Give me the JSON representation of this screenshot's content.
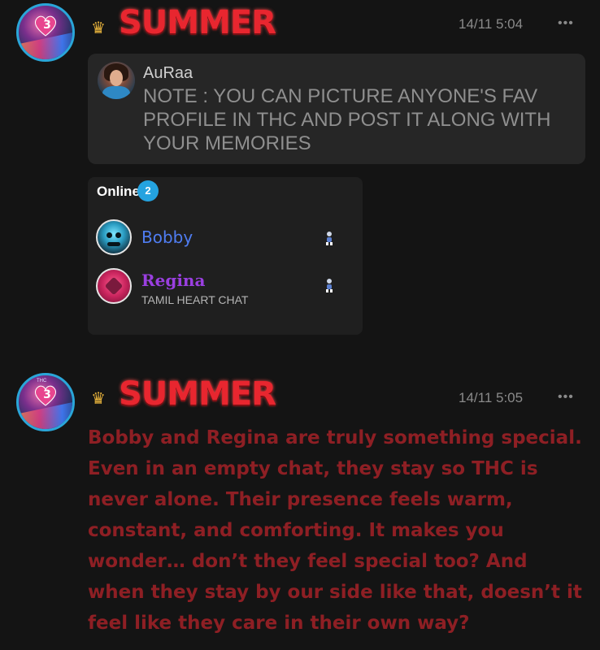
{
  "messages": [
    {
      "author": "SUMMER",
      "timestamp": "14/11 5:04",
      "avatar_label": "3",
      "quote": {
        "author": "AuRaa",
        "text": "NOTE : YOU CAN PICTURE ANYONE'S FAV PROFILE IN THC AND POST IT ALONG WITH YOUR MEMORIES"
      },
      "online_widget": {
        "title": "Online",
        "count": "2",
        "users": [
          {
            "name": "Bobby",
            "subtitle": ""
          },
          {
            "name": "Regina",
            "subtitle": "TAMIL HEART CHAT"
          }
        ]
      }
    },
    {
      "author": "SUMMER",
      "timestamp": "14/11 5:05",
      "avatar_label": "3",
      "avatar_tag": "THC",
      "text": "Bobby and Regina are truly something special. Even in an empty chat, they stay so THC is never alone. Their presence feels warm, constant, and comforting. It makes you wonder… don’t they feel special too? And when they stay by our side like that, doesn’t it feel like they care in their own way?"
    }
  ],
  "more_icon": "more-options-icon",
  "crown_icon": "crown-icon",
  "colors": {
    "background": "#141414",
    "author_red": "#e8262f",
    "body_text_red": "#8e1f24",
    "online_badge": "#24a3e0",
    "bobby_name": "#4f7df2",
    "regina_name": "#9a3fe0"
  }
}
